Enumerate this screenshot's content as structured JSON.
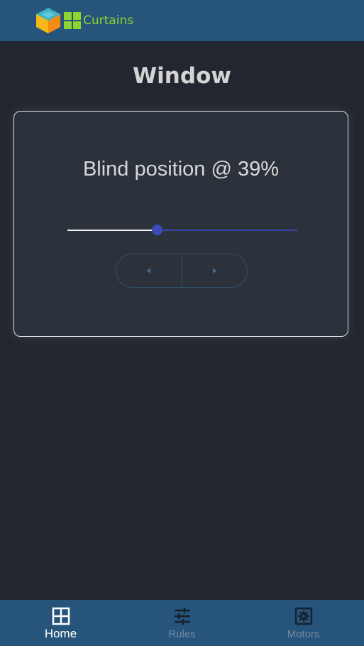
{
  "header": {
    "app_name": "Curtains",
    "logo_icon": "cube-logo-icon",
    "app_icon": "grid-tiles-icon",
    "accent_color": "#8ed62e"
  },
  "page": {
    "title": "Window"
  },
  "blind_card": {
    "heading": "Blind position @ 39%",
    "position_value": 39,
    "slider": {
      "min": 0,
      "max": 100,
      "value": 39
    },
    "buttons": {
      "left_icon": "caret-left-icon",
      "right_icon": "caret-right-icon"
    }
  },
  "bottom_nav": {
    "items": [
      {
        "label": "Home",
        "icon": "grid-icon",
        "active": true
      },
      {
        "label": "Rules",
        "icon": "sliders-icon",
        "active": false
      },
      {
        "label": "Motors",
        "icon": "motor-icon",
        "active": false
      }
    ]
  }
}
